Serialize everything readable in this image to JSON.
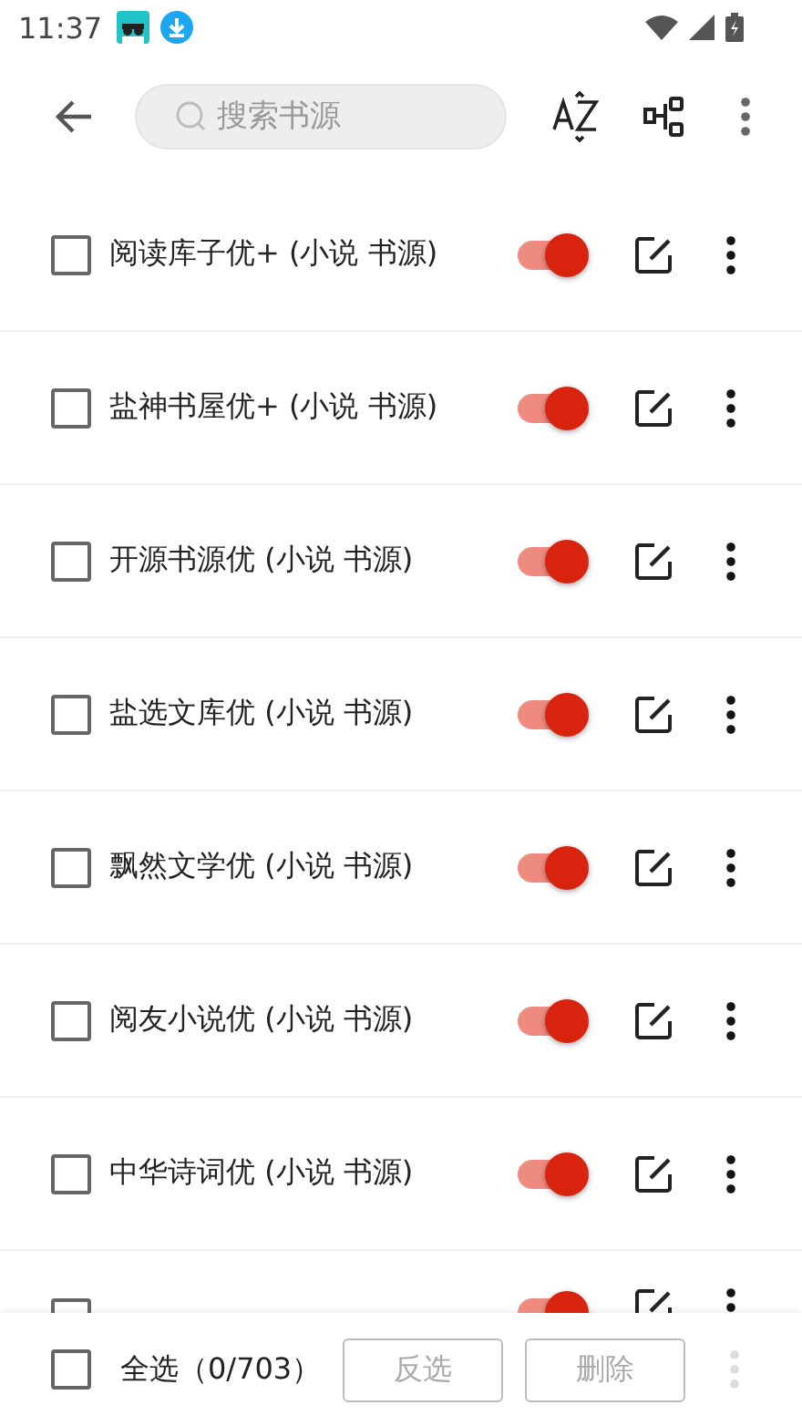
{
  "status_bar": {
    "time": "11:37"
  },
  "toolbar": {
    "search": {
      "placeholder": "搜索书源"
    }
  },
  "sources": [
    {
      "name": "阅读库子优+ (小说 书源)",
      "selected": false,
      "enabled": true
    },
    {
      "name": "盐神书屋优+ (小说 书源)",
      "selected": false,
      "enabled": true
    },
    {
      "name": "开源书源优 (小说 书源)",
      "selected": false,
      "enabled": true
    },
    {
      "name": "盐选文库优 (小说 书源)",
      "selected": false,
      "enabled": true
    },
    {
      "name": "飘然文学优 (小说 书源)",
      "selected": false,
      "enabled": true
    },
    {
      "name": "阅友小说优 (小说 书源)",
      "selected": false,
      "enabled": true
    },
    {
      "name": "中华诗词优 (小说 书源)",
      "selected": false,
      "enabled": true
    }
  ],
  "partial_row": {
    "selected": false,
    "enabled": true
  },
  "bottom_bar": {
    "select_all": {
      "label": "全选（0/703）",
      "checked": false
    },
    "buttons": [
      {
        "label": "反选",
        "disabled": true
      },
      {
        "label": "删除",
        "disabled": true
      }
    ],
    "more_disabled": true
  }
}
